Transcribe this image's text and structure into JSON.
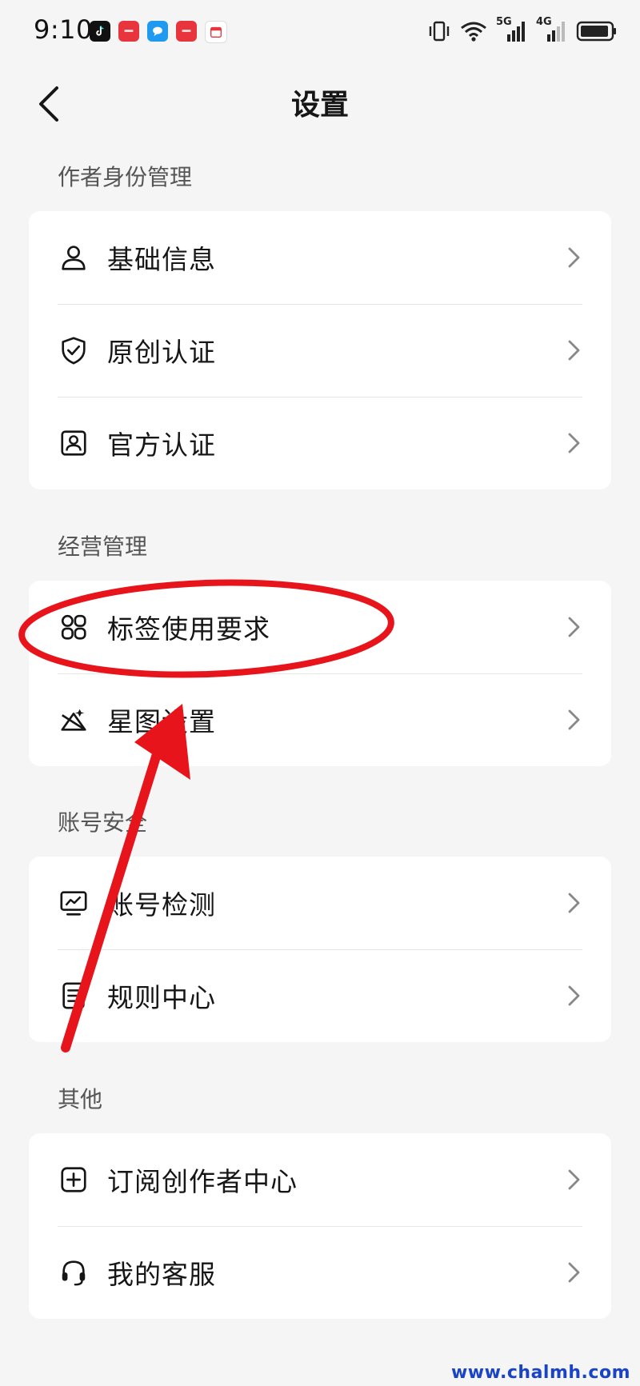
{
  "status_bar": {
    "time": "9:10",
    "app_icons": [
      "tiktok-icon",
      "huawei-app-icon",
      "message-icon",
      "huawei-app-icon",
      "calendar-icon"
    ],
    "indicators": [
      "vibrate-icon",
      "wifi-icon",
      "signal-5g-icon",
      "signal-4g-icon",
      "battery-icon"
    ],
    "network_5g": "5G",
    "network_4g": "4G"
  },
  "header": {
    "title": "设置",
    "back_icon": "chevron-left-icon"
  },
  "sections": [
    {
      "title": "作者身份管理",
      "items": [
        {
          "label": "基础信息",
          "icon": "user-icon"
        },
        {
          "label": "原创认证",
          "icon": "shield-check-icon"
        },
        {
          "label": "官方认证",
          "icon": "id-card-icon"
        }
      ]
    },
    {
      "title": "经营管理",
      "items": [
        {
          "label": "标签使用要求",
          "icon": "grid-icon"
        },
        {
          "label": "星图设置",
          "icon": "star-map-icon"
        }
      ]
    },
    {
      "title": "账号安全",
      "items": [
        {
          "label": "账号检测",
          "icon": "monitor-chart-icon"
        },
        {
          "label": "规则中心",
          "icon": "document-icon"
        }
      ]
    },
    {
      "title": "其他",
      "items": [
        {
          "label": "订阅创作者中心",
          "icon": "plus-square-icon"
        },
        {
          "label": "我的客服",
          "icon": "headset-icon"
        }
      ]
    }
  ],
  "annotation": {
    "color": "#e8141b"
  },
  "watermark": "www.chalmh.com"
}
